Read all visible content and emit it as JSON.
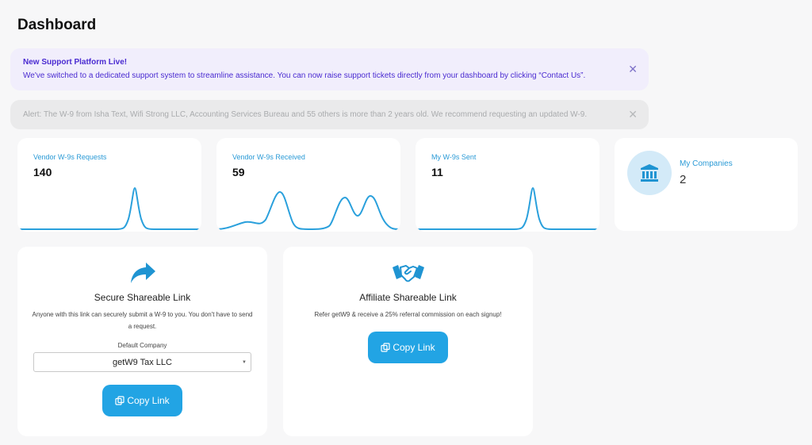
{
  "page": {
    "title": "Dashboard"
  },
  "banners": {
    "support": {
      "title": "New Support Platform Live!",
      "text": "We've switched to a dedicated support system to streamline assistance. You can now raise support tickets directly from your dashboard by clicking “Contact Us”."
    },
    "alert": {
      "text": "Alert: The W-9 from Isha Text, Wifi Strong LLC, Accounting Services Bureau and 55 others is more than 2 years old. We recommend requesting an updated W-9."
    },
    "close_glyph": "✕"
  },
  "stats": [
    {
      "label": "Vendor W-9s Requests",
      "value": "140"
    },
    {
      "label": "Vendor W-9s Received",
      "value": "59"
    },
    {
      "label": "My W-9s Sent",
      "value": "11"
    }
  ],
  "companies": {
    "label": "My Companies",
    "count": "2",
    "icon": "bank-icon"
  },
  "secure_link": {
    "icon": "share-arrow-icon",
    "title": "Secure Shareable Link",
    "description": "Anyone with this link can securely submit a W-9 to you. You don't have to send a request.",
    "field_label": "Default Company",
    "selected_company": "getW9 Tax LLC",
    "button_label": "Copy Link"
  },
  "affiliate_link": {
    "icon": "handshake-icon",
    "title": "Affiliate Shareable Link",
    "description": "Refer getW9 & receive a 25% referral commission on each signup!",
    "button_label": "Copy Link"
  },
  "colors": {
    "accent": "#22a4e4",
    "stat_label": "#2a9ad6",
    "support_banner_bg": "#f1eefc",
    "support_banner_text": "#4a2bd1",
    "alert_banner_bg": "#eaeaeb",
    "alert_banner_text": "#a9abad"
  }
}
